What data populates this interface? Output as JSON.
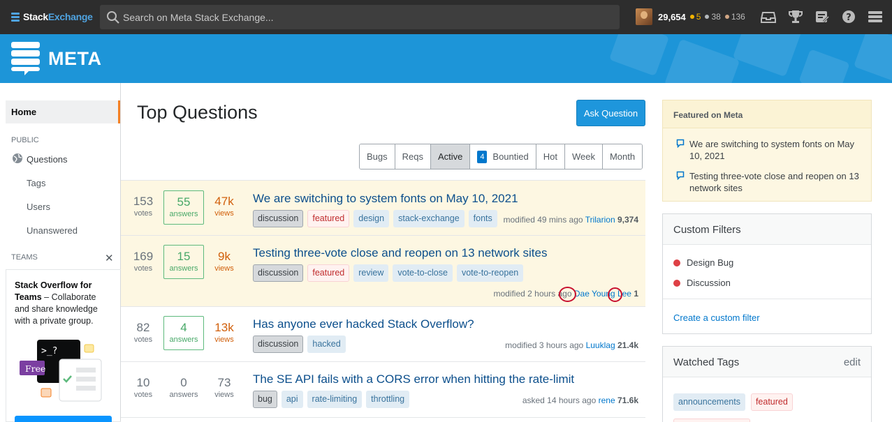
{
  "topbar": {
    "logo_plain": "Stack",
    "logo_accent": "Exchange",
    "search_placeholder": "Search on Meta Stack Exchange...",
    "reputation": "29,654",
    "badges": {
      "gold": "5",
      "silver": "38",
      "bronze": "136"
    },
    "badge_colors": {
      "gold": "#f2b400",
      "silver": "#b4b8bc",
      "bronze": "#d1a684"
    },
    "icons": [
      "inbox-icon",
      "achievements-icon",
      "review-queues-icon",
      "help-icon",
      "site-switcher-icon"
    ]
  },
  "banner": {
    "site_name": "META",
    "color": "#1d95d8"
  },
  "nav": {
    "home": "Home",
    "public_label": "PUBLIC",
    "questions": "Questions",
    "tags": "Tags",
    "users": "Users",
    "unanswered": "Unanswered",
    "teams_label": "TEAMS",
    "teams_title_bold": "Stack Overflow for Teams",
    "teams_title_rest": " – Collaborate and share knowledge with a private group.",
    "teams_free": "Free"
  },
  "main": {
    "title": "Top Questions",
    "ask_button": "Ask Question",
    "filters": [
      {
        "label": "Bugs"
      },
      {
        "label": "Reqs"
      },
      {
        "label": "Active"
      },
      {
        "label": "Bountied",
        "count": "4"
      },
      {
        "label": "Hot"
      },
      {
        "label": "Week"
      },
      {
        "label": "Month"
      }
    ],
    "active_filter": "Active",
    "questions": [
      {
        "votes": "153",
        "votes_label": "votes",
        "answers": "55",
        "answers_label": "answers",
        "views": "47k",
        "views_label": "views",
        "title": "We are switching to system fonts on May 10, 2021",
        "tags": [
          "discussion",
          "featured",
          "design",
          "stack-exchange",
          "fonts"
        ],
        "action": "modified 49 mins ago",
        "user": "Trilarion",
        "rep": "9,374"
      },
      {
        "votes": "169",
        "votes_label": "votes",
        "answers": "15",
        "answers_label": "answers",
        "views": "9k",
        "views_label": "views",
        "title": "Testing three-vote close and reopen on 13 network sites",
        "tags": [
          "discussion",
          "featured",
          "review",
          "vote-to-close",
          "vote-to-reopen"
        ],
        "action": "modified 2 hours ago",
        "user": "Dae Young Lee",
        "rep": "1"
      },
      {
        "votes": "82",
        "votes_label": "votes",
        "answers": "4",
        "answers_label": "answers",
        "views": "13k",
        "views_label": "views",
        "title": "Has anyone ever hacked Stack Overflow?",
        "tags": [
          "discussion",
          "hacked"
        ],
        "action": "modified 3 hours ago",
        "user": "Luuklag",
        "rep": "21.4k"
      },
      {
        "votes": "10",
        "votes_label": "votes",
        "answers": "0",
        "answers_label": "answers",
        "views": "73",
        "views_label": "views",
        "title": "The SE API fails with a CORS error when hitting the rate-limit",
        "tags": [
          "bug",
          "api",
          "rate-limiting",
          "throttling"
        ],
        "action": "asked 14 hours ago",
        "user": "rene",
        "rep": "71.6k"
      }
    ]
  },
  "sidebar": {
    "featured_title": "Featured on Meta",
    "featured_items": [
      "We are switching to system fonts on May 10, 2021",
      "Testing three-vote close and reopen on 13 network sites"
    ],
    "custom_filters_title": "Custom Filters",
    "custom_filters": [
      "Design Bug",
      "Discussion"
    ],
    "create_filter": "Create a custom filter",
    "watched_tags_title": "Watched Tags",
    "watched_edit": "edit",
    "watched_tags": [
      "announcements",
      "featured"
    ]
  }
}
